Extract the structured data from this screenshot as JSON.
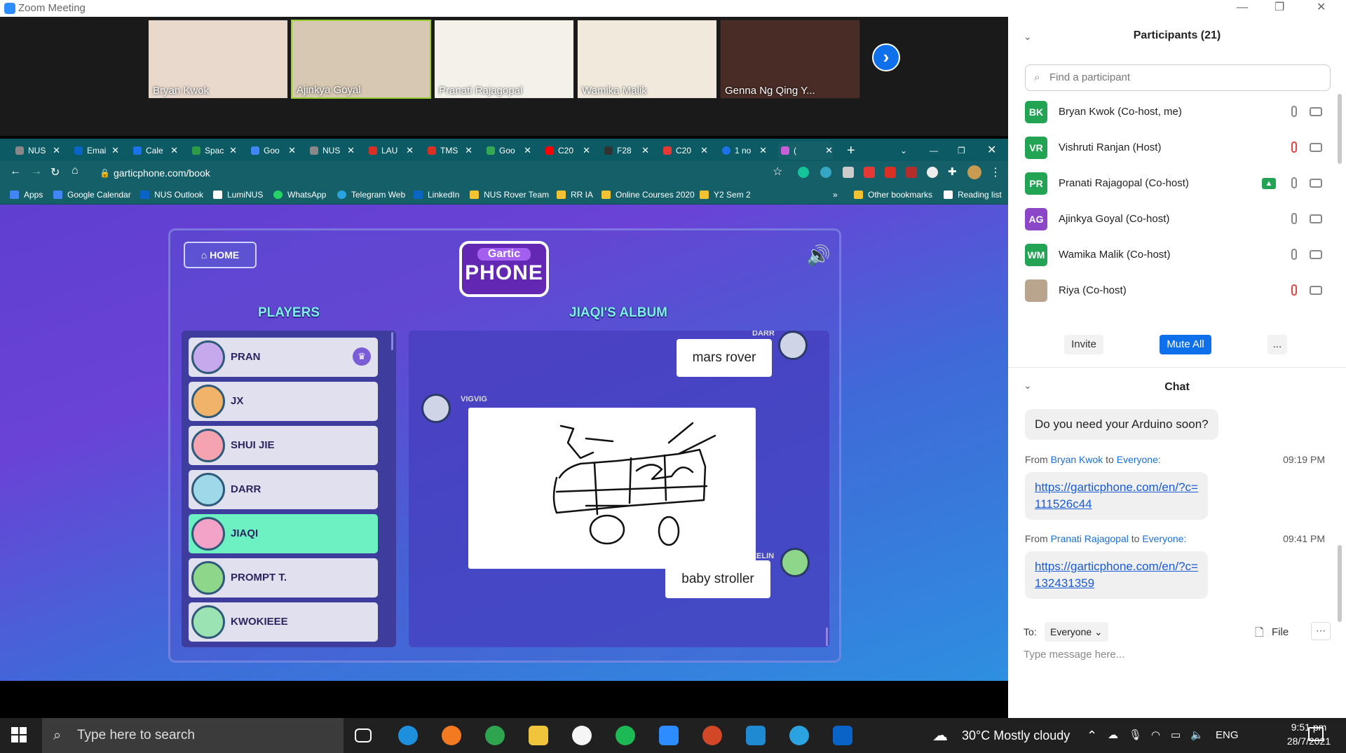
{
  "window": {
    "title": "Zoom Meeting"
  },
  "videos": [
    {
      "name": "Bryan Kwok",
      "bg": "#e9d8cc"
    },
    {
      "name": "Ajinkya Goyal",
      "bg": "#d6c8b2"
    },
    {
      "name": "Pranati Rajagopal",
      "bg": "#f4f1ea"
    },
    {
      "name": "Wamika Malik",
      "bg": "#f0e9dc"
    },
    {
      "name": "Genna Ng Qing Y...",
      "bg": "#4a2c26"
    }
  ],
  "browser": {
    "tabs": [
      "NUS",
      "Emai",
      "Cale",
      "Spac",
      "Goo",
      "NUS",
      "LAU",
      "TMS",
      "Goo",
      "C20",
      "F28",
      "C20",
      "1 no",
      "("
    ],
    "url": "garticphone.com/book",
    "bookmarks": [
      "Apps",
      "Google Calendar",
      "NUS Outlook",
      "LumiNUS",
      "WhatsApp",
      "Telegram Web",
      "LinkedIn",
      "NUS Rover Team",
      "RR IA",
      "Online Courses 2020",
      "Y2 Sem 2",
      "»",
      "Other bookmarks",
      "Reading list"
    ]
  },
  "game": {
    "home_label": "HOME",
    "logo_top": "Gartic",
    "logo_main": "PHONE",
    "players_header": "PLAYERS",
    "album_header": "JIAQI'S ALBUM",
    "players": [
      "PRAN",
      "JX",
      "SHUI JIE",
      "DARR",
      "JIAQI",
      "PROMPT T.",
      "KWOKIEEE"
    ],
    "highlighted_player": "JIAQI",
    "album": {
      "first_author": "DARR",
      "first_text": "mars rover",
      "drawing_author": "VIGVIG",
      "last_author": "SZELIN",
      "last_text": "baby stroller"
    }
  },
  "zoom": {
    "participants_title": "Participants (21)",
    "find_placeholder": "Find a participant",
    "participants": [
      {
        "initials": "BK",
        "name": "Bryan Kwok (Co-host, me)",
        "color": "#23a455",
        "muted": false
      },
      {
        "initials": "VR",
        "name": "Vishruti Ranjan (Host)",
        "color": "#23a455",
        "muted": true
      },
      {
        "initials": "PR",
        "name": "Pranati Rajagopal (Co-host)",
        "color": "#23a455",
        "muted": false
      },
      {
        "initials": "AG",
        "name": "Ajinkya Goyal (Co-host)",
        "color": "#8b47c8",
        "muted": false
      },
      {
        "initials": "WM",
        "name": "Wamika Malik (Co-host)",
        "color": "#23a455",
        "muted": false
      },
      {
        "initials": "",
        "name": "Riya (Co-host)",
        "color": "#b9a58e",
        "muted": true
      }
    ],
    "invite_label": "Invite",
    "mute_all_label": "Mute All",
    "more_label": "...",
    "chat_title": "Chat",
    "messages": [
      {
        "text": "Do you need your Arduino soon?"
      },
      {
        "from": "Bryan Kwok",
        "to": "Everyone:",
        "time": "09:19 PM",
        "link1": "https://garticphone.com/en/?c=",
        "link2": "111526c44"
      },
      {
        "from": "Pranati Rajagopal",
        "to": "Everyone:",
        "time": "09:41 PM",
        "link1": "https://garticphone.com/en/?c=",
        "link2": "132431359"
      }
    ],
    "from_word": "From",
    "to_word": "to",
    "to_label": "To:",
    "recipient": "Everyone",
    "file_label": "File",
    "message_placeholder": "Type message here..."
  },
  "taskbar": {
    "search_placeholder": "Type here to search",
    "weather": "30°C  Mostly cloudy",
    "lang": "ENG",
    "time": "9:51 pm",
    "date": "28/7/2021"
  }
}
